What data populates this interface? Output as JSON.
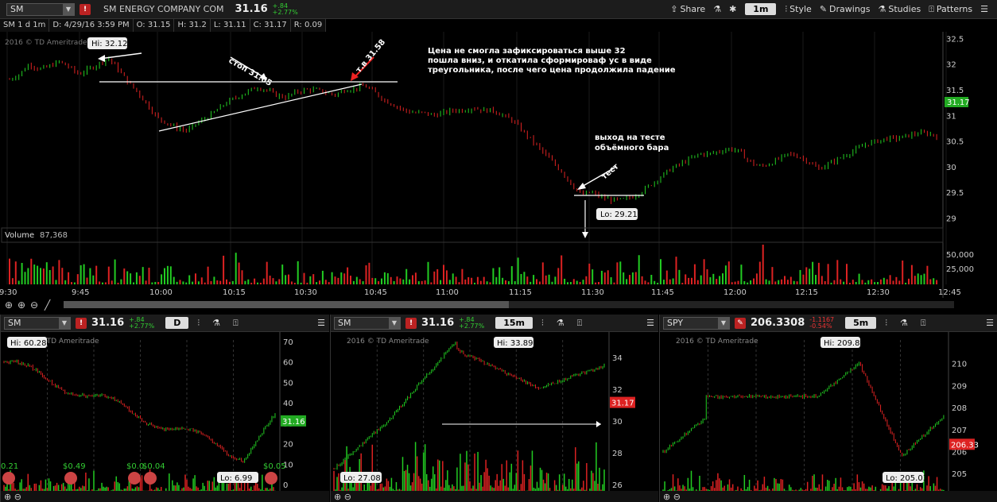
{
  "main": {
    "symbol": "SM",
    "company": "SM ENERGY COMPANY COM",
    "price": "31.16",
    "chg": "+.84",
    "chg_pct": "+2.77%",
    "toolbar": {
      "share": "Share",
      "timeframe": "1m",
      "style": "Style",
      "drawings": "Drawings",
      "studies": "Studies",
      "patterns": "Patterns"
    },
    "info": [
      "SM 1 d 1m",
      "D: 4/29/16 3:59 PM",
      "O: 31.15",
      "H: 31.2",
      "L: 31.11",
      "C: 31.17",
      "R: 0.09"
    ],
    "watermark": "2016 © TD Ameritrade Inc.",
    "hi_label": "Hi: 32.12",
    "lo_label": "Lo: 29.21",
    "last_label": "31.17",
    "annotations": {
      "stop": "стоп 31.65",
      "entry": "т.в 31.58",
      "test": "тест",
      "note1": "Цена не смогла зафиксироваться выше 32",
      "note2": "пошла вниз, и откатила сформироваф ус в виде",
      "note3": "треугольника, после чего цена продолжила падение",
      "exit1": "выход на тесте",
      "exit2": "объёмного бара"
    },
    "volume_label": "Volume",
    "volume_value": "87,368"
  },
  "bottom": [
    {
      "symbol": "SM",
      "price": "31.16",
      "chg": "+.84",
      "chg_pct": "+2.77%",
      "tf": "D",
      "watermark": "2016 © TD Ameritrade",
      "hi": "Hi: 60.28",
      "lo": "Lo: 6.99",
      "last": "31.16",
      "div_labels": [
        "0.21",
        "$0.49",
        "$0.0",
        "$0.04",
        "$0.05"
      ]
    },
    {
      "symbol": "SM",
      "price": "31.16",
      "chg": "+.84",
      "chg_pct": "+2.77%",
      "tf": "15m",
      "watermark": "2016 © TD Ameritrade",
      "hi": "Hi: 33.89",
      "lo": "Lo: 27.08",
      "last": "31.17"
    },
    {
      "symbol": "SPY",
      "price": "206.3308",
      "chg": "-1.1167",
      "chg_pct": "-0.54%",
      "tf": "5m",
      "watermark": "2016 © TD Ameritrade",
      "hi": "Hi: 209.81",
      "lo": "Lo: 205.03",
      "last": "206.33"
    }
  ],
  "chart_data": [
    {
      "type": "candlestick",
      "title": "SM 1 d 1m",
      "x_ticks": [
        "9:30",
        "9:45",
        "10:00",
        "10:15",
        "10:30",
        "10:45",
        "11:00",
        "11:15",
        "11:30",
        "11:45",
        "12:00",
        "12:15",
        "12:30",
        "12:45"
      ],
      "y_ticks": [
        29,
        29.5,
        30,
        30.5,
        31,
        31.5,
        32,
        32.5
      ],
      "ylim": [
        28.85,
        32.6
      ],
      "close": [
        31.7,
        31.8,
        32.0,
        31.9,
        31.95,
        32.05,
        31.95,
        31.8,
        31.9,
        32.0,
        32.12,
        31.9,
        31.65,
        31.45,
        31.2,
        30.95,
        30.85,
        30.75,
        30.7,
        30.85,
        30.95,
        31.1,
        31.25,
        31.35,
        31.45,
        31.55,
        31.5,
        31.4,
        31.35,
        31.45,
        31.5,
        31.5,
        31.45,
        31.4,
        31.5,
        31.52,
        31.58,
        31.45,
        31.3,
        31.2,
        31.1,
        31.05,
        31.05,
        31.0,
        31.05,
        31.1,
        31.1,
        31.15,
        31.1,
        31.1,
        31.0,
        30.9,
        30.7,
        30.5,
        30.3,
        30.1,
        29.9,
        29.65,
        29.45,
        29.5,
        29.4,
        29.35,
        29.35,
        29.4,
        29.5,
        29.65,
        29.8,
        29.95,
        30.05,
        30.15,
        30.25,
        30.25,
        30.3,
        30.35,
        30.3,
        30.1,
        30.0,
        30.05,
        30.15,
        30.25,
        30.2,
        30.1,
        29.95,
        30.05,
        30.15,
        30.25,
        30.35,
        30.45,
        30.5,
        30.55,
        30.55,
        30.6,
        30.65,
        30.65,
        30.6
      ],
      "volume_ticks": [
        "25,000",
        "50,000"
      ]
    },
    {
      "type": "candlestick",
      "panel": "SM D",
      "y_ticks": [
        0,
        10,
        20,
        30,
        40,
        50,
        60,
        70
      ]
    },
    {
      "type": "candlestick",
      "panel": "SM 15m",
      "y_ticks": [
        26,
        28,
        30,
        32,
        34
      ]
    },
    {
      "type": "candlestick",
      "panel": "SPY 5m",
      "y_ticks": [
        205,
        206,
        207,
        208,
        209,
        210
      ]
    }
  ]
}
